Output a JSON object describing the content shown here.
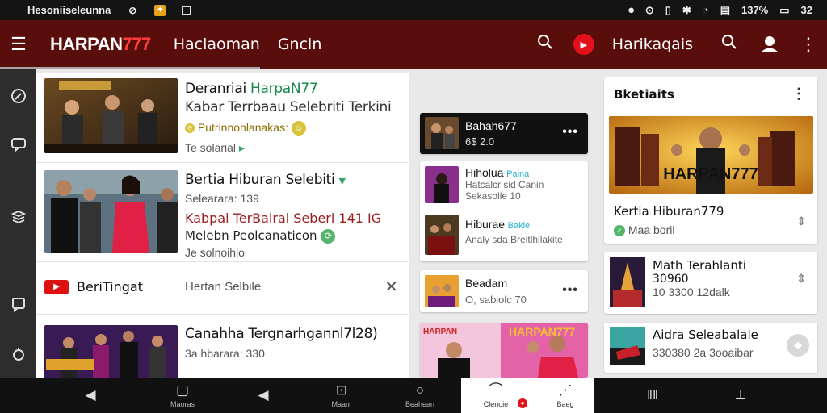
{
  "status_bar": {
    "app_name": "Hesoniiseleunna",
    "right_text": "137%",
    "right_text2": "32"
  },
  "app_bar": {
    "logo_main": "HARPAN",
    "logo_accent": "777",
    "nav_1": "Haclaoman",
    "nav_2": "Gncln",
    "account_title": "Harikaqais"
  },
  "feed": [
    {
      "title_prefix": "Deranriai ",
      "title_accent": "HarpaN77",
      "subtitle": "Kabar Terrbaau Selebriti Terkini",
      "meta_yellow": "Putrinnohlanakas:",
      "meta": "Te solarial",
      "meta_arrow": "▸"
    },
    {
      "title": "Bertia  Hiburan Selebiti",
      "meta": "Selearara: 139",
      "red_line": "Kabpai TerBairal Seberi 141 IG",
      "green_line": "Melebn Peolcanaticon",
      "meta2": "Je solnoihlo"
    },
    {
      "badge_label": "BeriTingat",
      "search_hint": "Hertan Selbile",
      "close": "✕"
    },
    {
      "title": "Canahha Tergnarhgannl7l28)",
      "meta": "3a hbarara: 330"
    }
  ],
  "mid_cards": [
    {
      "name": "Bahah677",
      "meta": "6$ 2.0",
      "dots": "•••"
    },
    {
      "name": "Hiholua",
      "blue": "Paina",
      "sub": "Hatcalcr sid Canin",
      "meta": "Sekasolle 10"
    },
    {
      "name": "Hiburae",
      "blue": "Bakle",
      "sub": "Analy sda Breitlhilakite"
    },
    {
      "name": "Beadam",
      "meta": "O, sabiolc 70",
      "dots": "•••"
    }
  ],
  "mid_poster": {
    "text": "HARPAN777",
    "text_left": "HARPAN"
  },
  "right_cards": [
    {
      "title": "Bketiaits",
      "banner": "HARPAN777",
      "caption": "Kertia Hiburan779",
      "meta": "Maa boril"
    },
    {
      "title": "Math Terahlanti",
      "line2": "30960",
      "meta": "10 3300 12dalk"
    },
    {
      "title": "Aidra Seleabalale",
      "meta": "330380 2a 3ooaibar"
    }
  ],
  "bottom_nav": [
    {
      "icon": "back-icon",
      "label": ""
    },
    {
      "icon": "home-square-icon",
      "label": "Maoras"
    },
    {
      "icon": "play-icon",
      "label": ""
    },
    {
      "icon": "gallery-icon",
      "label": "Maam"
    },
    {
      "icon": "circle-icon",
      "label": "Beahean"
    },
    {
      "icon": "profile-icon",
      "label": "Clenoie"
    },
    {
      "icon": "share-icon",
      "label": "Baeg"
    },
    {
      "icon": "bars-icon",
      "label": ""
    },
    {
      "icon": "device-icon",
      "label": ""
    }
  ],
  "colors": {
    "app_bar": "#5a0e0c",
    "accent_red": "#e4111c",
    "accent_green": "#14894a",
    "link_blue": "#26b0c9"
  }
}
